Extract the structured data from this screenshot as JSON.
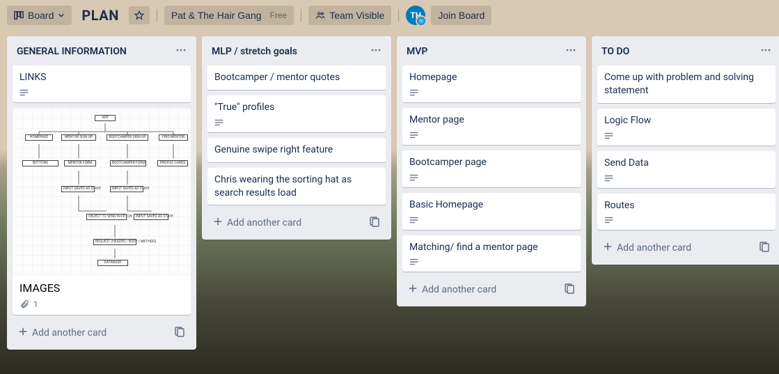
{
  "topbar": {
    "view_switch_label": "Board",
    "board_title": "PLAN",
    "team_name": "Pat & The Hair Gang",
    "plan_badge": "Free",
    "visibility_label": "Team Visible",
    "avatar_initials": "TH",
    "join_label": "Join Board"
  },
  "lists": [
    {
      "title": "GENERAL INFORMATION",
      "cards": [
        {
          "title": "LINKS",
          "has_description": true
        },
        {
          "title": "IMAGES",
          "has_description": false,
          "attachments": 1,
          "cover": true
        }
      ],
      "add_label": "Add another card"
    },
    {
      "title": "MLP / stretch goals",
      "cards": [
        {
          "title": "Bootcamper / mentor quotes",
          "has_description": false
        },
        {
          "title": "\"True\" profiles",
          "has_description": true
        },
        {
          "title": "Genuine swipe right feature",
          "has_description": false
        },
        {
          "title": "Chris wearing the sorting hat as search results load",
          "has_description": false
        }
      ],
      "add_label": "Add another card"
    },
    {
      "title": "MVP",
      "cards": [
        {
          "title": "Homepage",
          "has_description": true
        },
        {
          "title": "Mentor page",
          "has_description": true
        },
        {
          "title": "Bootcamper page",
          "has_description": true
        },
        {
          "title": "Basic Homepage",
          "has_description": true
        },
        {
          "title": "Matching/ find a mentor page",
          "has_description": true
        }
      ],
      "add_label": "Add another card"
    },
    {
      "title": "TO DO",
      "cards": [
        {
          "title": "Come up with problem and solving statement",
          "has_description": false
        },
        {
          "title": "Logic Flow",
          "has_description": true
        },
        {
          "title": "Send Data",
          "has_description": true
        },
        {
          "title": "Routes",
          "has_description": true
        }
      ],
      "add_label": "Add another card"
    }
  ]
}
